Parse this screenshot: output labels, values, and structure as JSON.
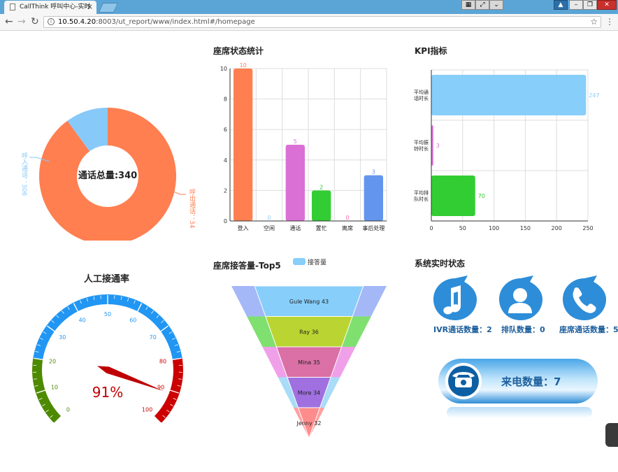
{
  "browser": {
    "tab_title": "CallThink 呼叫中心-实时",
    "tab_close": "×",
    "back": "←",
    "forward": "→",
    "reload": "↻",
    "info": "i",
    "url_host": "10.50.4.20",
    "url_rest": ":8003/ut_report/www/index.html#/homepage",
    "star": "☆",
    "menu": "⋮"
  },
  "donut": {
    "center_label": "通话总量:340",
    "inbound_label": "呼入通话",
    "inbound_value": 306,
    "outbound_label": "呼出通话",
    "outbound_value": 34,
    "inbound_color": "#87c9f8",
    "outbound_color": "#ff7f50",
    "inbound_value_text": "306",
    "outbound_value_text": "34",
    "sep": "："
  },
  "status": {
    "title": "座席状态统计",
    "chart_data": {
      "type": "bar",
      "categories": [
        "登入",
        "空闲",
        "通话",
        "置忙",
        "离席",
        "事后处理"
      ],
      "values": [
        10,
        0,
        5,
        2,
        0,
        3
      ],
      "colors": [
        "#ff7f50",
        "#87cefa",
        "#da70d6",
        "#32cd32",
        "#ff69b4",
        "#6495ed"
      ],
      "ylim": [
        0,
        10
      ],
      "yticks": [
        0,
        2,
        4,
        6,
        8,
        10
      ],
      "grid": true
    }
  },
  "kpi": {
    "title": "KPI指标",
    "chart_data": {
      "type": "bar",
      "orientation": "horizontal",
      "categories": [
        "平均通话时长",
        "平均振铃时长",
        "平均排队时长"
      ],
      "category_lines": [
        [
          "平均通",
          "话时长"
        ],
        [
          "平均振",
          "铃时长"
        ],
        [
          "平均排",
          "队时长"
        ]
      ],
      "values": [
        247,
        3,
        70
      ],
      "colors": [
        "#87cefa",
        "#da70d6",
        "#32cd32"
      ],
      "xlim": [
        0,
        250
      ],
      "xticks": [
        0,
        50,
        100,
        150,
        200,
        250
      ],
      "grid": true
    }
  },
  "gauge": {
    "title": "人工接通率",
    "value": 91,
    "value_text": "91%",
    "min": 0,
    "max": 100,
    "ticks": [
      "0",
      "10",
      "20",
      "30",
      "40",
      "50",
      "60",
      "70",
      "80",
      "90",
      "100"
    ],
    "bands": [
      {
        "to": 0.2,
        "color": "#4d8a00"
      },
      {
        "to": 0.8,
        "color": "#2196f3"
      },
      {
        "to": 1.0,
        "color": "#cc0000"
      }
    ],
    "pointer_color": "#c00000"
  },
  "top5": {
    "title": "座席接答量-Top5",
    "legend": "接答量",
    "legend_color": "#87cefa",
    "chart_data": {
      "type": "funnel",
      "series": [
        {
          "name": "接答量",
          "values": [
            43,
            36,
            35,
            34,
            32
          ]
        }
      ],
      "categories": [
        "Gule Wang",
        "Ray",
        "Mina",
        "More",
        "Jenny"
      ],
      "colors": [
        "#87cefa",
        "#bad531",
        "#da70a6",
        "#a070e0",
        "#ff8c8c"
      ],
      "side_colors": [
        "#a4b8f8",
        "#7fe070",
        "#f0a0e8",
        "#a8dcf8",
        "#ffa0a0"
      ]
    }
  },
  "system": {
    "title": "系统实时状态",
    "items": [
      {
        "label": "IVR通话数量：",
        "value": "2",
        "icon": "music-note-icon"
      },
      {
        "label": "排队数量：",
        "value": "0",
        "icon": "person-icon"
      },
      {
        "label": "座席通话数量：",
        "value": "5",
        "icon": "phone-icon"
      }
    ],
    "incoming_label": "来电数量：",
    "incoming_value": "7",
    "accent": "#2d8dd8"
  }
}
